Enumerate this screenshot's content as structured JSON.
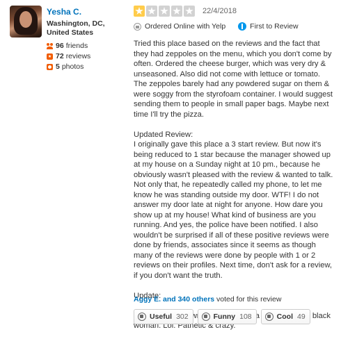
{
  "user": {
    "name": "Yesha C.",
    "location": "Washington, DC, United States",
    "friends": "96",
    "friends_label": "friends",
    "reviews": "72",
    "reviews_label": "reviews",
    "photos": "5",
    "photos_label": "photos"
  },
  "review": {
    "rating": 1,
    "rating_max": 5,
    "date": "22/4/2018",
    "ordered_label": "Ordered Online with Yelp",
    "first_label": "First to Review",
    "paragraphs": [
      "Tried this place based on the reviews and the fact that they had zeppoles on the menu, which you don't come by often. Ordered the cheese burger, which was very dry & unseasoned. Also did not come with lettuce or tomato. The zeppoles barely had any powdered sugar on them & were soggy from the styrofoam container. I would suggest sending them to people in small paper bags. Maybe next time I'll try the pizza.",
      "Updated Review:\nI originally gave this place a 3 start review. But now it's being reduced to 1 star because the manager showed up at my house on a Sunday night at 10 pm., because he obviously wasn't pleased with the review & wanted to talk. Not only that, he repeatedly called my phone, to let me know he was standing outside my door. WTF! I do not answer my door late at night for anyone. How dare you show up at my house! What kind of business are you running. And yes, the police have been notified. I also wouldn't be surprised if all of these positive reviews were done by friends, associates since it seems as though many of the reviews were done by people with 1 or 2 reviews on their profiles. Next time, don't ask for a review, if you don't want the truth.",
      "Update:",
      "Funny how the owner is now using a profile pic of a black woman. Lol. Pathetic & crazy."
    ],
    "voters_link": "Aggy E. and 340 others",
    "voters_suffix": " voted for this review",
    "buttons": {
      "useful_label": "Useful",
      "useful_count": "302",
      "funny_label": "Funny",
      "funny_count": "108",
      "cool_label": "Cool",
      "cool_count": "49"
    }
  }
}
